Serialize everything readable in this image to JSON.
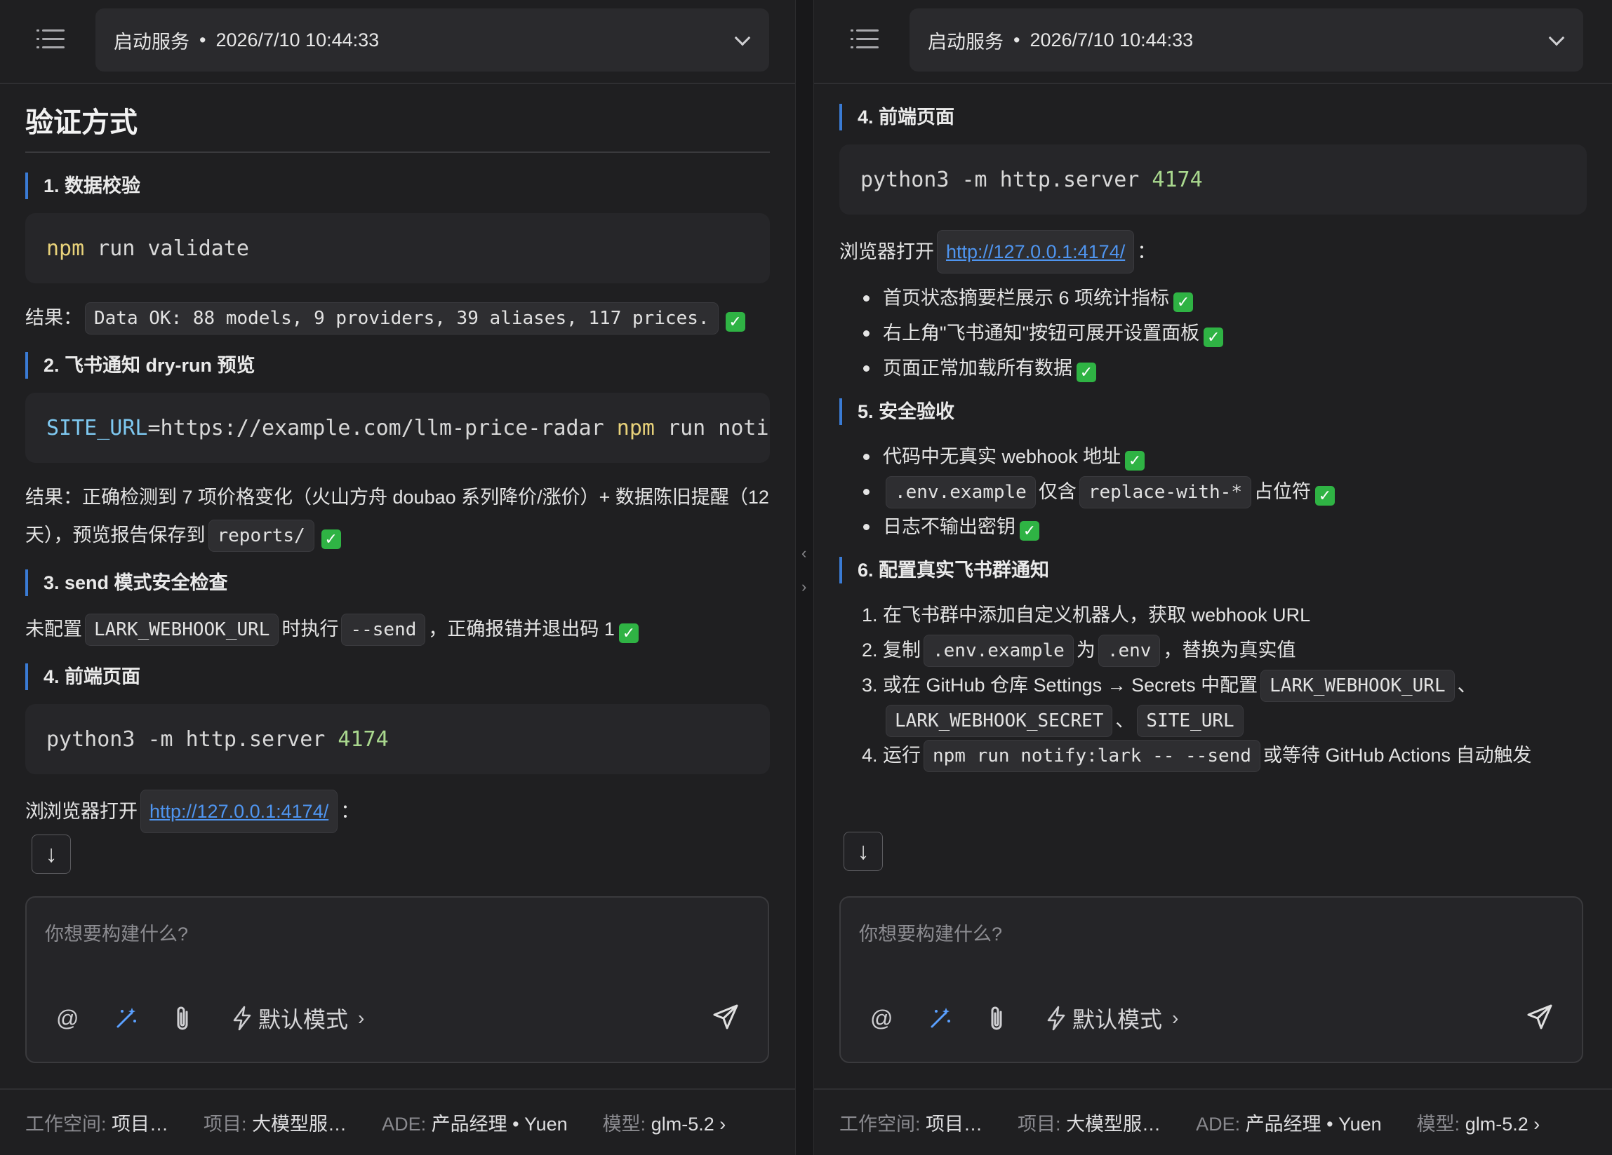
{
  "header": {
    "session_title": "启动服务",
    "session_time": "2026/7/10 10:44:33"
  },
  "left": {
    "heading": "验证方式",
    "s1": {
      "title": "1. 数据校验",
      "code_kw": "npm",
      "code_rest": " run validate",
      "result_label": "结果：",
      "result_code": "Data OK: 88 models, 9 providers, 39 aliases, 117 prices."
    },
    "s2": {
      "title": "2. 飞书通知 dry-run 预览",
      "code_var": "SITE_URL",
      "code_mid": "=https://example.com/llm-price-radar ",
      "code_kw": "npm",
      "code_rest": " run notif",
      "result_text_1": "结果：正确检测到 7 项价格变化（火山方舟 doubao 系列降价/涨价）+ 数据陈旧提醒（12天），预览报告保存到",
      "result_code": "reports/"
    },
    "s3": {
      "title": "3. send 模式安全检查",
      "t1": "未配置",
      "c1": "LARK_WEBHOOK_URL",
      "t2": "时执行",
      "c2": "--send",
      "t3": "，正确报错并退出码 1"
    },
    "s4": {
      "title": "4. 前端页面",
      "code_pre": "python3 -m http.server ",
      "code_num": "4174",
      "browser_label": "浏览器打开",
      "browser_hidden": "浏",
      "link": "http://127.0.0.1:4174/",
      "colon": "："
    }
  },
  "right": {
    "s4": {
      "title": "4. 前端页面",
      "code_pre": "python3 -m http.server ",
      "code_num": "4174",
      "browser_label": "浏览器打开",
      "link": "http://127.0.0.1:4174/",
      "colon": "：",
      "items": [
        "首页状态摘要栏展示 6 项统计指标",
        "右上角\"飞书通知\"按钮可展开设置面板",
        "页面正常加载所有数据"
      ]
    },
    "s5": {
      "title": "5. 安全验收",
      "item1": "代码中无真实 webhook 地址",
      "item2_code1": ".env.example",
      "item2_t1": "仅含",
      "item2_code2": "replace-with-*",
      "item2_t2": "占位符",
      "item3": "日志不输出密钥"
    },
    "s6": {
      "title": "6. 配置真实飞书群通知",
      "i1": "在飞书群中添加自定义机器人，获取 webhook URL",
      "i2_t1": "复制",
      "i2_c1": ".env.example",
      "i2_t2": "为",
      "i2_c2": ".env",
      "i2_t3": "，替换为真实值",
      "i3_t1": "或在 GitHub 仓库 Settings → Secrets 中配置",
      "i3_c1": "LARK_WEBHOOK_URL",
      "i3_sep1": "、",
      "i3_c2": "LARK_WEBHOOK_SECRET",
      "i3_sep2": "、",
      "i3_c3": "SITE_URL",
      "i4_t1": "运行",
      "i4_c1": "npm run notify:lark -- --send",
      "i4_t2": "或等待 GitHub Actions 自动触发"
    }
  },
  "input": {
    "placeholder": "你想要构建什么?",
    "mode_label": "默认模式"
  },
  "footer": {
    "workspace_label": "工作空间:",
    "workspace_value": "项目…",
    "project_label": "项目:",
    "project_value": "大模型服…",
    "ade_label": "ADE:",
    "ade_value": "产品经理",
    "user": "Yuen",
    "model_label": "模型:",
    "model_value": "glm-5.2"
  },
  "colors": {
    "accent": "#3a7bd5",
    "link": "#4f95f0",
    "check": "#2fb344",
    "keyword": "#e8d27a",
    "number": "#a9d88e"
  }
}
